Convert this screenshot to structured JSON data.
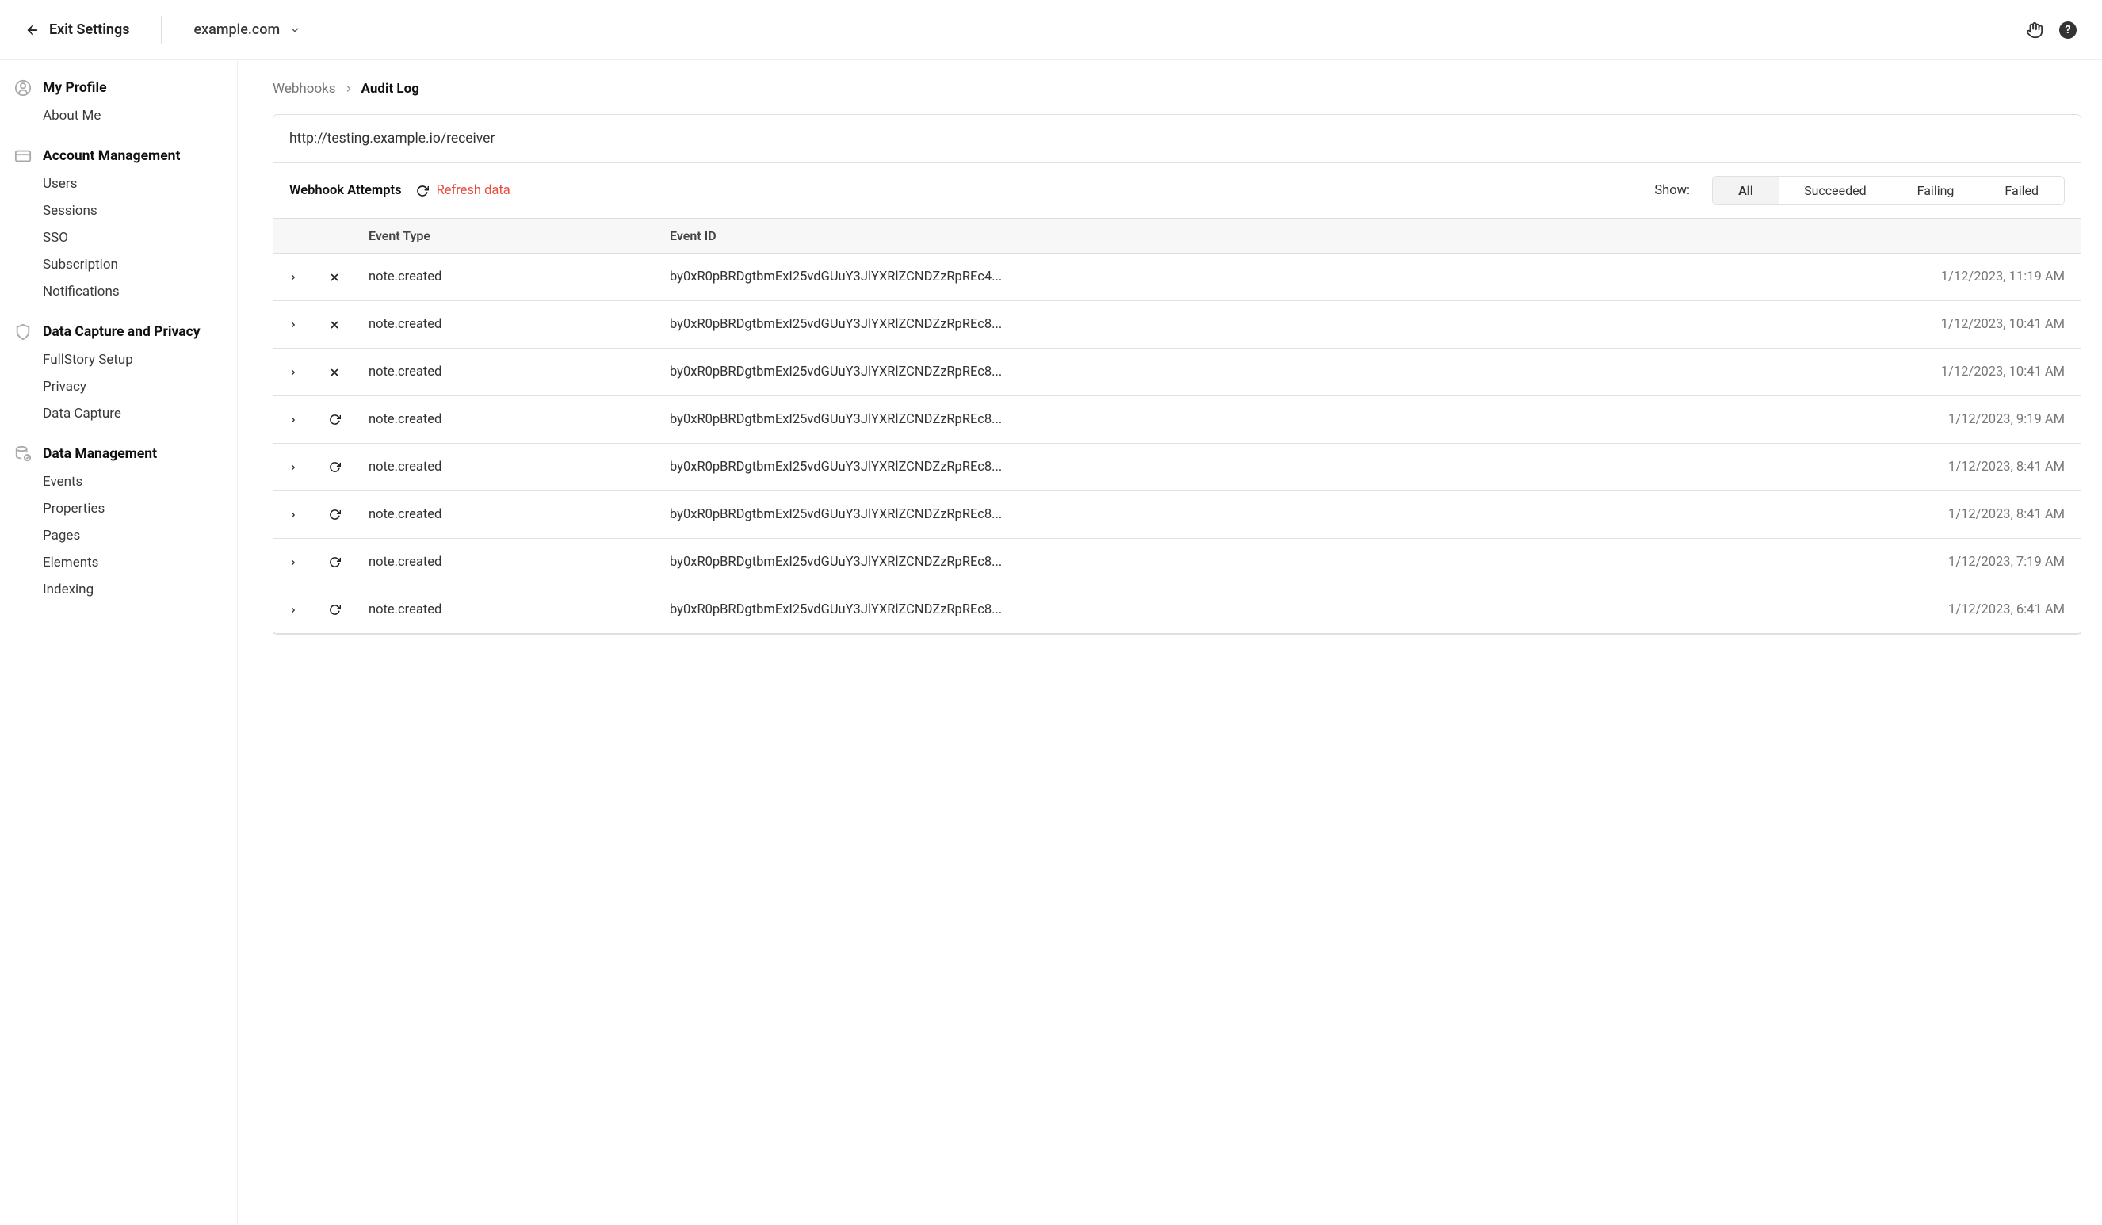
{
  "header": {
    "exit_label": "Exit Settings",
    "domain": "example.com"
  },
  "sidebar": [
    {
      "icon": "user",
      "title": "My Profile",
      "items": [
        "About Me"
      ]
    },
    {
      "icon": "card",
      "title": "Account Management",
      "items": [
        "Users",
        "Sessions",
        "SSO",
        "Subscription",
        "Notifications"
      ]
    },
    {
      "icon": "shield",
      "title": "Data Capture and Privacy",
      "items": [
        "FullStory Setup",
        "Privacy",
        "Data Capture"
      ]
    },
    {
      "icon": "db",
      "title": "Data Management",
      "items": [
        "Events",
        "Properties",
        "Pages",
        "Elements",
        "Indexing"
      ]
    }
  ],
  "breadcrumb": {
    "parent": "Webhooks",
    "current": "Audit Log"
  },
  "webhook_url": "http://testing.example.io/receiver",
  "attempts_label": "Webhook Attempts",
  "refresh_label": "Refresh data",
  "show_label": "Show:",
  "filters": [
    "All",
    "Succeeded",
    "Failing",
    "Failed"
  ],
  "active_filter": "All",
  "columns": {
    "type": "Event Type",
    "id": "Event ID"
  },
  "rows": [
    {
      "status": "failed",
      "type": "note.created",
      "id": "by0xR0pBRDgtbmExI25vdGUuY3JlYXRlZCNDZzRpREc4...",
      "time": "1/12/2023, 11:19 AM"
    },
    {
      "status": "failed",
      "type": "note.created",
      "id": "by0xR0pBRDgtbmExI25vdGUuY3JlYXRlZCNDZzRpREc8...",
      "time": "1/12/2023, 10:41 AM"
    },
    {
      "status": "failed",
      "type": "note.created",
      "id": "by0xR0pBRDgtbmExI25vdGUuY3JlYXRlZCNDZzRpREc8...",
      "time": "1/12/2023, 10:41 AM"
    },
    {
      "status": "retry",
      "type": "note.created",
      "id": "by0xR0pBRDgtbmExI25vdGUuY3JlYXRlZCNDZzRpREc8...",
      "time": "1/12/2023, 9:19 AM"
    },
    {
      "status": "retry",
      "type": "note.created",
      "id": "by0xR0pBRDgtbmExI25vdGUuY3JlYXRlZCNDZzRpREc8...",
      "time": "1/12/2023, 8:41 AM"
    },
    {
      "status": "retry",
      "type": "note.created",
      "id": "by0xR0pBRDgtbmExI25vdGUuY3JlYXRlZCNDZzRpREc8...",
      "time": "1/12/2023, 8:41 AM"
    },
    {
      "status": "retry",
      "type": "note.created",
      "id": "by0xR0pBRDgtbmExI25vdGUuY3JlYXRlZCNDZzRpREc8...",
      "time": "1/12/2023, 7:19 AM"
    },
    {
      "status": "retry",
      "type": "note.created",
      "id": "by0xR0pBRDgtbmExI25vdGUuY3JlYXRlZCNDZzRpREc8...",
      "time": "1/12/2023, 6:41 AM"
    }
  ]
}
